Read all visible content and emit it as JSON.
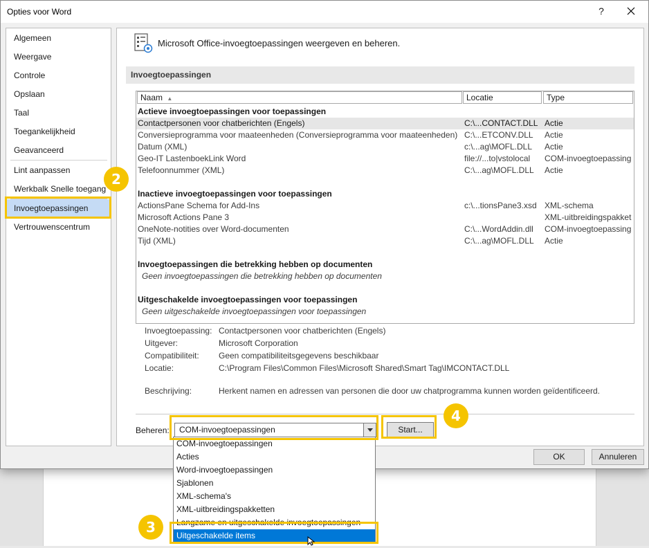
{
  "window": {
    "title": "Opties voor Word",
    "help": "?",
    "close_icon": "close-icon"
  },
  "sidebar": {
    "items": [
      {
        "label": "Algemeen"
      },
      {
        "label": "Weergave"
      },
      {
        "label": "Controle"
      },
      {
        "label": "Opslaan"
      },
      {
        "label": "Taal"
      },
      {
        "label": "Toegankelijkheid"
      },
      {
        "label": "Geavanceerd"
      },
      {
        "label": "Lint aanpassen"
      },
      {
        "label": "Werkbalk Snelle toegang"
      },
      {
        "label": "Invoegtoepassingen",
        "active": true
      },
      {
        "label": "Vertrouwenscentrum"
      }
    ]
  },
  "main": {
    "header_title": "Microsoft Office-invoegtoepassingen weergeven en beheren.",
    "section_title": "Invoegtoepassingen",
    "table": {
      "columns": [
        "Naam",
        "Locatie",
        "Type"
      ],
      "sort_indicator": "▲",
      "group_active": "Actieve invoegtoepassingen voor toepassingen",
      "active_rows": [
        {
          "name": "Contactpersonen voor chatberichten (Engels)",
          "location": "C:\\...CONTACT.DLL",
          "type": "Actie"
        },
        {
          "name": "Conversieprogramma voor maateenheden (Conversieprogramma voor maateenheden)",
          "location": "C:\\...ETCONV.DLL",
          "type": "Actie"
        },
        {
          "name": "Datum (XML)",
          "location": "c:\\...ag\\MOFL.DLL",
          "type": "Actie"
        },
        {
          "name": "Geo-IT LastenboekLink Word",
          "location": "file://...to|vstolocal",
          "type": "COM-invoegtoepassing"
        },
        {
          "name": "Telefoonnummer (XML)",
          "location": "C:\\...ag\\MOFL.DLL",
          "type": "Actie"
        }
      ],
      "group_inactive": "Inactieve invoegtoepassingen voor toepassingen",
      "inactive_rows": [
        {
          "name": "ActionsPane Schema for Add-Ins",
          "location": "c:\\...tionsPane3.xsd",
          "type": "XML-schema"
        },
        {
          "name": "Microsoft Actions Pane 3",
          "location": "",
          "type": "XML-uitbreidingspakket"
        },
        {
          "name": "OneNote-notities over Word-documenten",
          "location": "C:\\...WordAddin.dll",
          "type": "COM-invoegtoepassing"
        },
        {
          "name": "Tijd (XML)",
          "location": "C:\\...ag\\MOFL.DLL",
          "type": "Actie"
        }
      ],
      "group_documents": "Invoegtoepassingen die betrekking hebben op documenten",
      "documents_note": "Geen invoegtoepassingen die betrekking hebben op documenten",
      "group_disabled": "Uitgeschakelde invoegtoepassingen voor toepassingen",
      "disabled_note": "Geen uitgeschakelde invoegtoepassingen voor toepassingen"
    },
    "details": {
      "addin_label": "Invoegtoepassing:",
      "addin_value": "Contactpersonen voor chatberichten (Engels)",
      "publisher_label": "Uitgever:",
      "publisher_value": "Microsoft Corporation",
      "compat_label": "Compatibiliteit:",
      "compat_value": "Geen compatibiliteitsgegevens beschikbaar",
      "location_label": "Locatie:",
      "location_value": "C:\\Program Files\\Common Files\\Microsoft Shared\\Smart Tag\\IMCONTACT.DLL",
      "description_label": "Beschrijving:",
      "description_value": "Herkent namen en adressen van personen die door uw chatprogramma kunnen worden geïdentificeerd."
    },
    "manage": {
      "label": "Beheren:",
      "selected": "COM-invoegtoepassingen",
      "start_button": "Start..."
    }
  },
  "footer": {
    "ok": "OK",
    "cancel": "Annuleren"
  },
  "dropdown": {
    "options": [
      "COM-invoegtoepassingen",
      "Acties",
      "Word-invoegtoepassingen",
      "Sjablonen",
      "XML-schema's",
      "XML-uitbreidingspakketten",
      "Langzame en uitgeschakelde invoegtoepassingen",
      "Uitgeschakelde items"
    ],
    "highlighted_index": 7
  },
  "annotations": {
    "badge_2": "2",
    "badge_3": "3",
    "badge_4": "4",
    "color": "#f5c400"
  }
}
